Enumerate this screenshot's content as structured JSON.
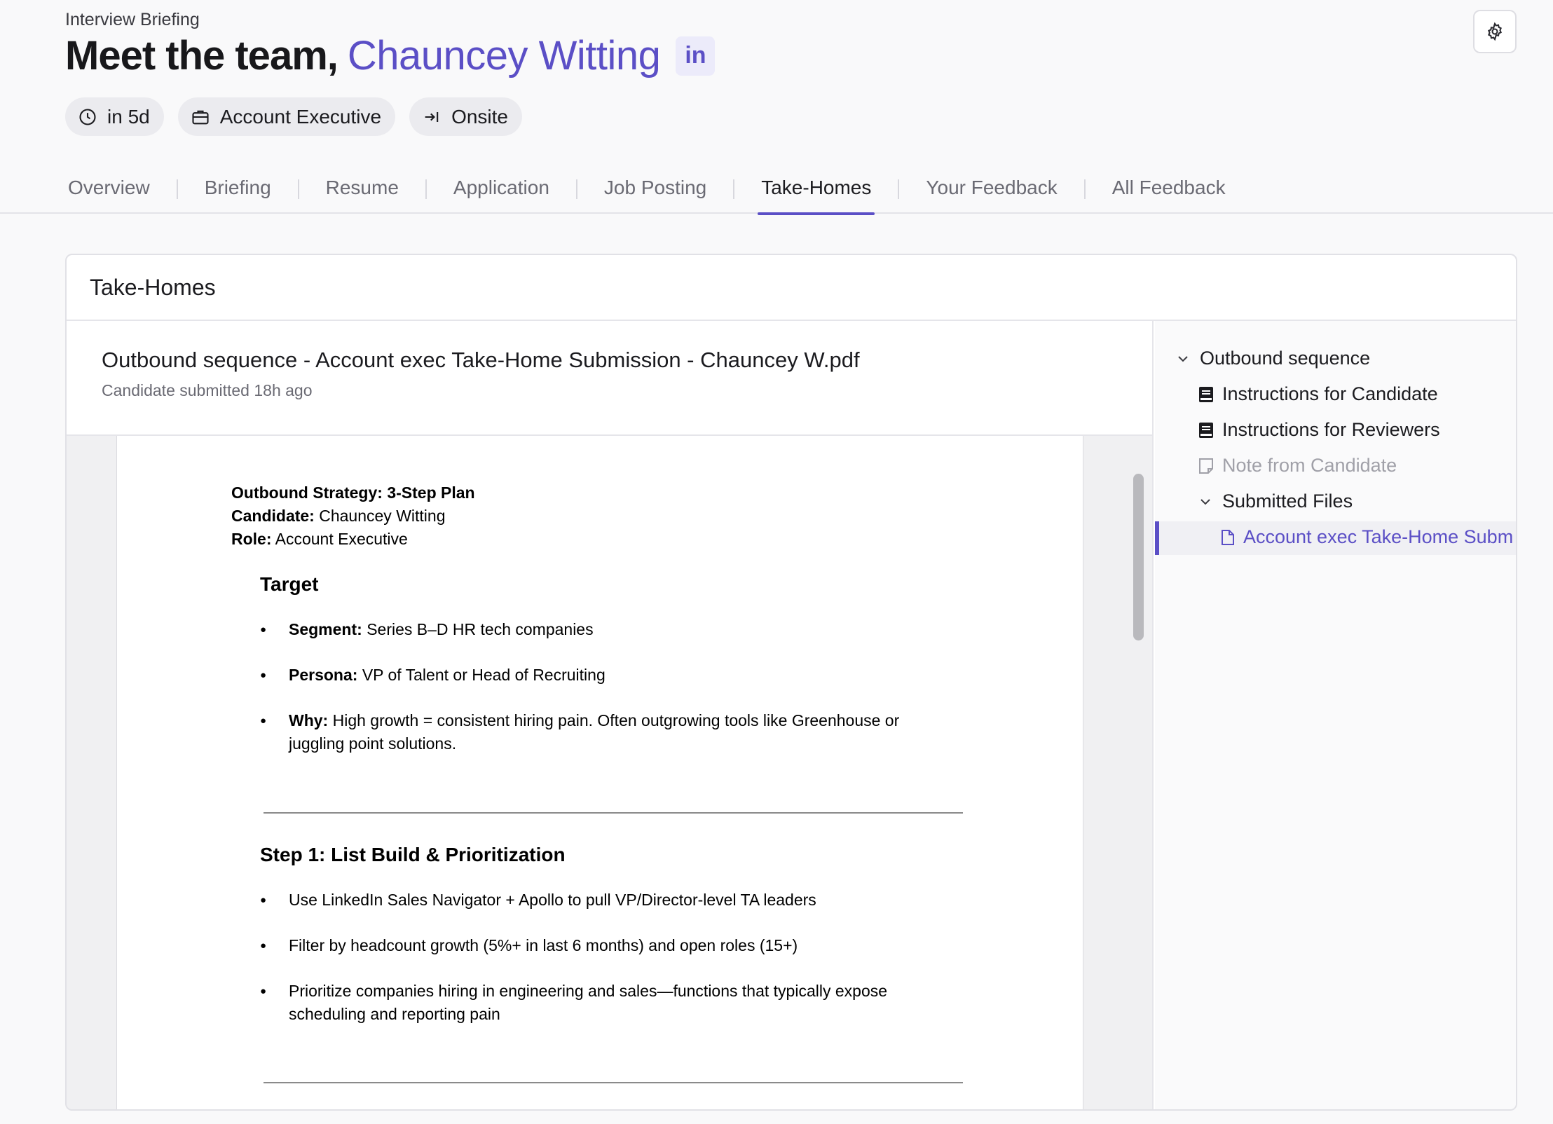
{
  "header": {
    "eyebrow": "Interview Briefing",
    "title_prefix": "Meet the team,",
    "candidate_name": "Chauncey Witting",
    "linkedin_label": "in",
    "pills": [
      {
        "icon": "clock-icon",
        "label": "in 5d"
      },
      {
        "icon": "briefcase-icon",
        "label": "Account Executive"
      },
      {
        "icon": "arrow-right-to-line-icon",
        "label": "Onsite"
      }
    ]
  },
  "tabs": [
    {
      "label": "Overview"
    },
    {
      "label": "Briefing"
    },
    {
      "label": "Resume"
    },
    {
      "label": "Application"
    },
    {
      "label": "Job Posting"
    },
    {
      "label": "Take-Homes",
      "active": true
    },
    {
      "label": "Your Feedback"
    },
    {
      "label": "All Feedback"
    }
  ],
  "card": {
    "title": "Take-Homes",
    "file_title": "Outbound sequence - Account exec Take-Home Submission - Chauncey W.pdf",
    "file_subtitle": "Candidate submitted 18h ago"
  },
  "document": {
    "heading_label": "Outbound Strategy:",
    "heading_value": "3-Step Plan",
    "candidate_label": "Candidate:",
    "candidate_value": "Chauncey Witting",
    "role_label": "Role:",
    "role_value": "Account Executive",
    "target_heading": "Target",
    "target_items": [
      {
        "label": "Segment:",
        "text": "Series B–D HR tech companies"
      },
      {
        "label": "Persona:",
        "text": "VP of Talent or Head of Recruiting"
      },
      {
        "label": "Why:",
        "text": "High growth = consistent hiring pain. Often outgrowing tools like Greenhouse or juggling point solutions."
      }
    ],
    "step1_heading": "Step 1: List Build & Prioritization",
    "step1_items": [
      "Use LinkedIn Sales Navigator + Apollo to pull VP/Director-level TA leaders",
      "Filter by headcount growth (5%+ in last 6 months) and open roles (15+)",
      "Prioritize companies hiring in engineering and sales—functions that typically expose scheduling and reporting pain"
    ]
  },
  "sidebar": {
    "group": "Outbound sequence",
    "items": [
      {
        "icon": "book-icon",
        "label": "Instructions for Candidate"
      },
      {
        "icon": "book-icon",
        "label": "Instructions for Reviewers"
      },
      {
        "icon": "note-icon",
        "label": "Note from Candidate",
        "muted": true
      }
    ],
    "subgroup": "Submitted Files",
    "file": "Account exec Take-Home Subm"
  },
  "colors": {
    "accent": "#5b4fc6",
    "background": "#f9f9fa"
  }
}
